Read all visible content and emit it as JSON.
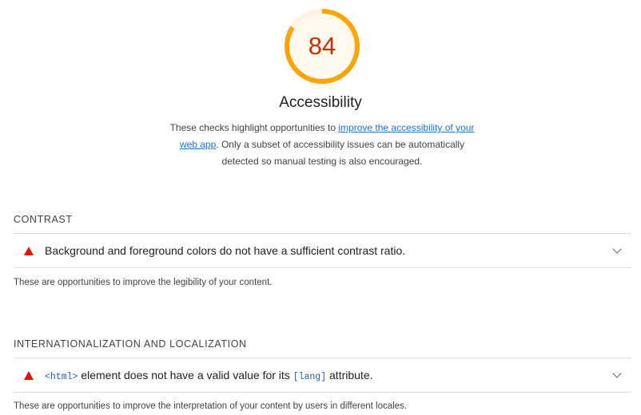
{
  "score": {
    "value": "84",
    "fraction": 0.84,
    "ring_color": "#ffa400",
    "track_color": "#fff3e0",
    "fill_color": "#fff8ee",
    "text_color": "#c33300"
  },
  "category": {
    "title": "Accessibility",
    "desc_prefix": "These checks highlight opportunities to ",
    "desc_link": "improve the accessibility of your web app",
    "desc_suffix": ". Only a subset of accessibility issues can be automatically detected so manual testing is also encouraged."
  },
  "groups": [
    {
      "header": "CONTRAST",
      "audit": {
        "title": "Background and foreground colors do not have a sufficient contrast ratio.",
        "icon": "fail-triangle-icon",
        "status_color": "#eb0f00"
      },
      "description": "These are opportunities to improve the legibility of your content."
    },
    {
      "header": "INTERNATIONALIZATION AND LOCALIZATION",
      "audit": {
        "code1": "<html>",
        "text1": " element does not have a valid value for its ",
        "code2": "[lang]",
        "text2": " attribute.",
        "icon": "fail-triangle-icon",
        "status_color": "#eb0f00"
      },
      "description": "These are opportunities to improve the interpretation of your content by users in different locales."
    }
  ],
  "colors": {
    "link": "#1a73e8",
    "code": "#1e5fb3",
    "divider": "#e0e0e0"
  }
}
